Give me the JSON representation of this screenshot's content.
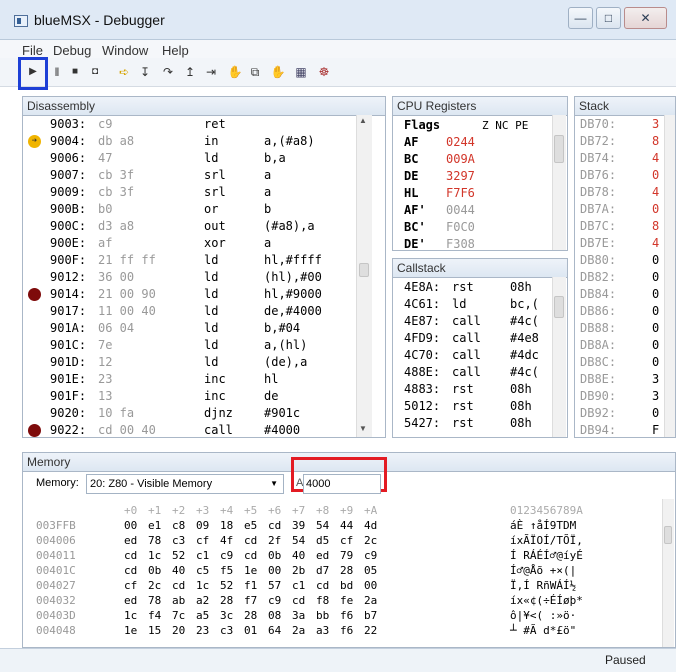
{
  "window": {
    "title": "blueMSX - Debugger"
  },
  "menu": [
    "File",
    "Debug",
    "Window",
    "Help"
  ],
  "disassembly": {
    "title": "Disassembly",
    "rows": [
      {
        "addr": "9003:",
        "bytes": "c9",
        "op": "ret",
        "args": "",
        "marker": ""
      },
      {
        "addr": "9004:",
        "bytes": "db a8",
        "op": "in",
        "args": "a,(#a8)",
        "marker": "arrow"
      },
      {
        "addr": "9006:",
        "bytes": "47",
        "op": "ld",
        "args": "b,a",
        "marker": ""
      },
      {
        "addr": "9007:",
        "bytes": "cb 3f",
        "op": "srl",
        "args": "a",
        "marker": ""
      },
      {
        "addr": "9009:",
        "bytes": "cb 3f",
        "op": "srl",
        "args": "a",
        "marker": ""
      },
      {
        "addr": "900B:",
        "bytes": "b0",
        "op": "or",
        "args": "b",
        "marker": ""
      },
      {
        "addr": "900C:",
        "bytes": "d3 a8",
        "op": "out",
        "args": "(#a8),a",
        "marker": ""
      },
      {
        "addr": "900E:",
        "bytes": "af",
        "op": "xor",
        "args": "a",
        "marker": ""
      },
      {
        "addr": "900F:",
        "bytes": "21 ff ff",
        "op": "ld",
        "args": "hl,#ffff",
        "marker": ""
      },
      {
        "addr": "9012:",
        "bytes": "36 00",
        "op": "ld",
        "args": "(hl),#00",
        "marker": ""
      },
      {
        "addr": "9014:",
        "bytes": "21 00 90",
        "op": "ld",
        "args": "hl,#9000",
        "marker": "bp"
      },
      {
        "addr": "9017:",
        "bytes": "11 00 40",
        "op": "ld",
        "args": "de,#4000",
        "marker": ""
      },
      {
        "addr": "901A:",
        "bytes": "06 04",
        "op": "ld",
        "args": "b,#04",
        "marker": ""
      },
      {
        "addr": "901C:",
        "bytes": "7e",
        "op": "ld",
        "args": "a,(hl)",
        "marker": ""
      },
      {
        "addr": "901D:",
        "bytes": "12",
        "op": "ld",
        "args": "(de),a",
        "marker": ""
      },
      {
        "addr": "901E:",
        "bytes": "23",
        "op": "inc",
        "args": "hl",
        "marker": ""
      },
      {
        "addr": "901F:",
        "bytes": "13",
        "op": "inc",
        "args": "de",
        "marker": ""
      },
      {
        "addr": "9020:",
        "bytes": "10 fa",
        "op": "djnz",
        "args": "#901c",
        "marker": ""
      },
      {
        "addr": "9022:",
        "bytes": "cd 00 40",
        "op": "call",
        "args": "#4000",
        "marker": "bp"
      }
    ]
  },
  "registers": {
    "title": "CPU Registers",
    "flags_label": "Flags",
    "flags": "Z NC PE",
    "rows": [
      {
        "name": "AF",
        "value": "0244",
        "color": "red"
      },
      {
        "name": "BC",
        "value": "009A",
        "color": "red"
      },
      {
        "name": "DE",
        "value": "3297",
        "color": "red"
      },
      {
        "name": "HL",
        "value": "F7F6",
        "color": "red"
      },
      {
        "name": "AF'",
        "value": "0044",
        "color": "gray"
      },
      {
        "name": "BC'",
        "value": "F0C0",
        "color": "gray"
      },
      {
        "name": "DE'",
        "value": "F308",
        "color": "gray"
      }
    ]
  },
  "stack": {
    "title": "Stack",
    "rows": [
      {
        "addr": "DB70:",
        "val": "3",
        "color": "red"
      },
      {
        "addr": "DB72:",
        "val": "8",
        "color": "red"
      },
      {
        "addr": "DB74:",
        "val": "4",
        "color": "red"
      },
      {
        "addr": "DB76:",
        "val": "0",
        "color": "red"
      },
      {
        "addr": "DB78:",
        "val": "4",
        "color": "red"
      },
      {
        "addr": "DB7A:",
        "val": "0",
        "color": "red"
      },
      {
        "addr": "DB7C:",
        "val": "8",
        "color": "red"
      },
      {
        "addr": "DB7E:",
        "val": "4",
        "color": "red"
      },
      {
        "addr": "DB80:",
        "val": "0",
        "color": "black"
      },
      {
        "addr": "DB82:",
        "val": "0",
        "color": "black"
      },
      {
        "addr": "DB84:",
        "val": "0",
        "color": "black"
      },
      {
        "addr": "DB86:",
        "val": "0",
        "color": "black"
      },
      {
        "addr": "DB88:",
        "val": "0",
        "color": "black"
      },
      {
        "addr": "DB8A:",
        "val": "0",
        "color": "black"
      },
      {
        "addr": "DB8C:",
        "val": "0",
        "color": "black"
      },
      {
        "addr": "DB8E:",
        "val": "3",
        "color": "black"
      },
      {
        "addr": "DB90:",
        "val": "3",
        "color": "black"
      },
      {
        "addr": "DB92:",
        "val": "0",
        "color": "black"
      },
      {
        "addr": "DB94:",
        "val": "F",
        "color": "black"
      }
    ]
  },
  "callstack": {
    "title": "Callstack",
    "rows": [
      {
        "addr": "4E8A:",
        "op": "rst",
        "arg": "08h"
      },
      {
        "addr": "4C61:",
        "op": "ld",
        "arg": "bc,("
      },
      {
        "addr": "4E87:",
        "op": "call",
        "arg": "#4c("
      },
      {
        "addr": "4FD9:",
        "op": "call",
        "arg": "#4e8"
      },
      {
        "addr": "4C70:",
        "op": "call",
        "arg": "#4dc"
      },
      {
        "addr": "488E:",
        "op": "call",
        "arg": "#4c("
      },
      {
        "addr": "4883:",
        "op": "rst",
        "arg": "08h"
      },
      {
        "addr": "5012:",
        "op": "rst",
        "arg": "08h"
      },
      {
        "addr": "5427:",
        "op": "rst",
        "arg": "08h"
      }
    ]
  },
  "memory": {
    "title": "Memory",
    "memory_label": "Memory:",
    "selected": "20: Z80 - Visible Memory",
    "addr_label": "A",
    "addr_value": "4000",
    "header_offsets": [
      "+0",
      "+1",
      "+2",
      "+3",
      "+4",
      "+5",
      "+6",
      "+7",
      "+8",
      "+9",
      "+A"
    ],
    "header_ascii": "0123456789A",
    "rows": [
      {
        "addr": "003FFB",
        "bytes": [
          "00",
          "e1",
          "c8",
          "09",
          "18",
          "e5",
          "cd",
          "39",
          "54",
          "44",
          "4d"
        ],
        "ascii": "áÈ ↑åÍ9TDM"
      },
      {
        "addr": "004006",
        "bytes": [
          "ed",
          "78",
          "c3",
          "cf",
          "4f",
          "cd",
          "2f",
          "54",
          "d5",
          "cf",
          "2c"
        ],
        "ascii": "íxÃÏOÍ/TÕÏ,"
      },
      {
        "addr": "004011",
        "bytes": [
          "cd",
          "1c",
          "52",
          "c1",
          "c9",
          "cd",
          "0b",
          "40",
          "ed",
          "79",
          "c9"
        ],
        "ascii": "Í RÁÉÍ♂@íyÉ"
      },
      {
        "addr": "00401C",
        "bytes": [
          "cd",
          "0b",
          "40",
          "c5",
          "f5",
          "1e",
          "00",
          "2b",
          "d7",
          "28",
          "05"
        ],
        "ascii": "Í♂@Åõ  +×(|"
      },
      {
        "addr": "004027",
        "bytes": [
          "cf",
          "2c",
          "cd",
          "1c",
          "52",
          "f1",
          "57",
          "c1",
          "cd",
          "bd",
          "00"
        ],
        "ascii": "Ï,Í RñWÁÍ½"
      },
      {
        "addr": "004032",
        "bytes": [
          "ed",
          "78",
          "ab",
          "a2",
          "28",
          "f7",
          "c9",
          "cd",
          "f8",
          "fe",
          "2a"
        ],
        "ascii": "íx«¢(÷ÉÍøþ*"
      },
      {
        "addr": "00403D",
        "bytes": [
          "1c",
          "f4",
          "7c",
          "a5",
          "3c",
          "28",
          "08",
          "3a",
          "bb",
          "f6",
          "b7"
        ],
        "ascii": "ô|¥<( :»ö·"
      },
      {
        "addr": "004048",
        "bytes": [
          "1e",
          "15",
          "20",
          "23",
          "c3",
          "01",
          "64",
          "2a",
          "a3",
          "f6",
          "22"
        ],
        "ascii": "┴ #Ã d*£ö\""
      }
    ]
  },
  "status": {
    "text": "Paused"
  }
}
